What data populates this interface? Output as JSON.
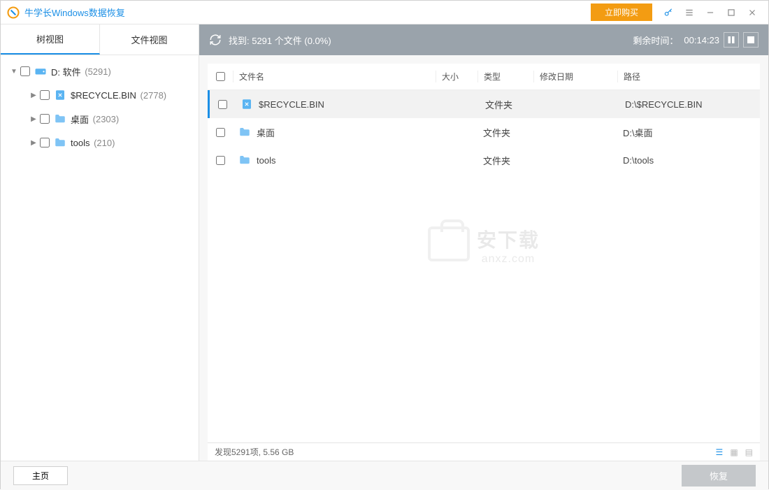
{
  "app": {
    "title": "牛学长Windows数据恢复"
  },
  "titlebar": {
    "buy": "立即购买"
  },
  "tabs": {
    "tree": "树视图",
    "file": "文件视图"
  },
  "status": {
    "found_text": "找到: 5291 个文件 (0.0%)",
    "time_label": "剩余时间：",
    "time_value": "00:14:23"
  },
  "tree": {
    "root": {
      "label": "D: 软件",
      "count": "(5291)"
    },
    "items": [
      {
        "label": "$RECYCLE.BIN",
        "count": "(2778)",
        "icon": "recycle"
      },
      {
        "label": "桌面",
        "count": "(2303)",
        "icon": "folder"
      },
      {
        "label": "tools",
        "count": "(210)",
        "icon": "folder"
      }
    ]
  },
  "table": {
    "headers": {
      "name": "文件名",
      "size": "大小",
      "type": "类型",
      "date": "修改日期",
      "path": "路径"
    },
    "rows": [
      {
        "name": "$RECYCLE.BIN",
        "type": "文件夹",
        "path": "D:\\$RECYCLE.BIN",
        "icon": "recycle",
        "selected": true
      },
      {
        "name": "桌面",
        "type": "文件夹",
        "path": "D:\\桌面",
        "icon": "folder",
        "selected": false
      },
      {
        "name": "tools",
        "type": "文件夹",
        "path": "D:\\tools",
        "icon": "folder",
        "selected": false
      }
    ]
  },
  "watermark": {
    "line1": "安下载",
    "line2": "anxz.com"
  },
  "footer": {
    "summary": "发现5291项, 5.56 GB"
  },
  "bottom": {
    "home": "主页",
    "recover": "恢复"
  }
}
